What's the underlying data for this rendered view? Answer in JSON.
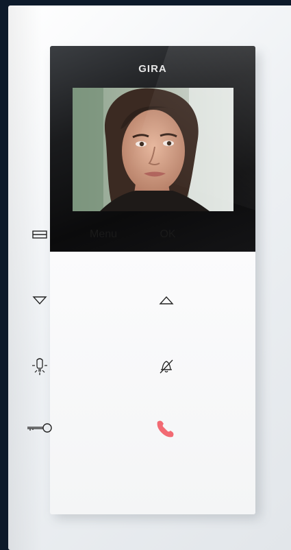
{
  "device": {
    "brand": "GIRA",
    "keys": {
      "menu_label": "Menu",
      "ok_label": "OK"
    },
    "icons": {
      "screen": "screen-toggle-icon",
      "down": "arrow-down-icon",
      "up": "arrow-up-icon",
      "light": "light-bulb-icon",
      "mute": "bell-mute-icon",
      "door": "door-key-icon",
      "call": "phone-handset-icon"
    },
    "colors": {
      "call_accent": "#f26a73",
      "panel_dark": "#111214",
      "keypad_bg": "#f6f7f8"
    }
  }
}
